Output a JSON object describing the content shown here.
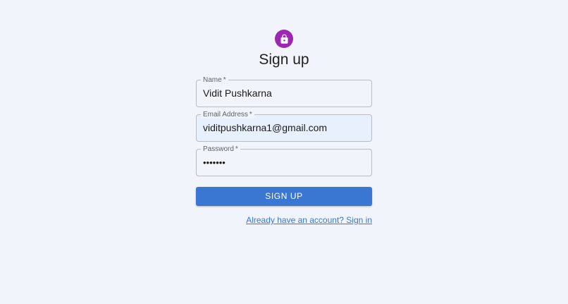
{
  "icons": {
    "avatar": "lock-icon"
  },
  "colors": {
    "avatar_bg": "#9c27b0",
    "primary": "#3a77d2",
    "background": "#f1f4fa",
    "autofill": "#e8f0fe"
  },
  "form": {
    "title": "Sign up",
    "required_mark": "*",
    "name": {
      "label": "Name",
      "value": "Vidit Pushkarna"
    },
    "email": {
      "label": "Email Address",
      "value": "viditpushkarna1@gmail.com"
    },
    "password": {
      "label": "Password",
      "value": "•••••••"
    },
    "submit_label": "SIGN UP",
    "signin_link": "Already have an account? Sign in"
  }
}
